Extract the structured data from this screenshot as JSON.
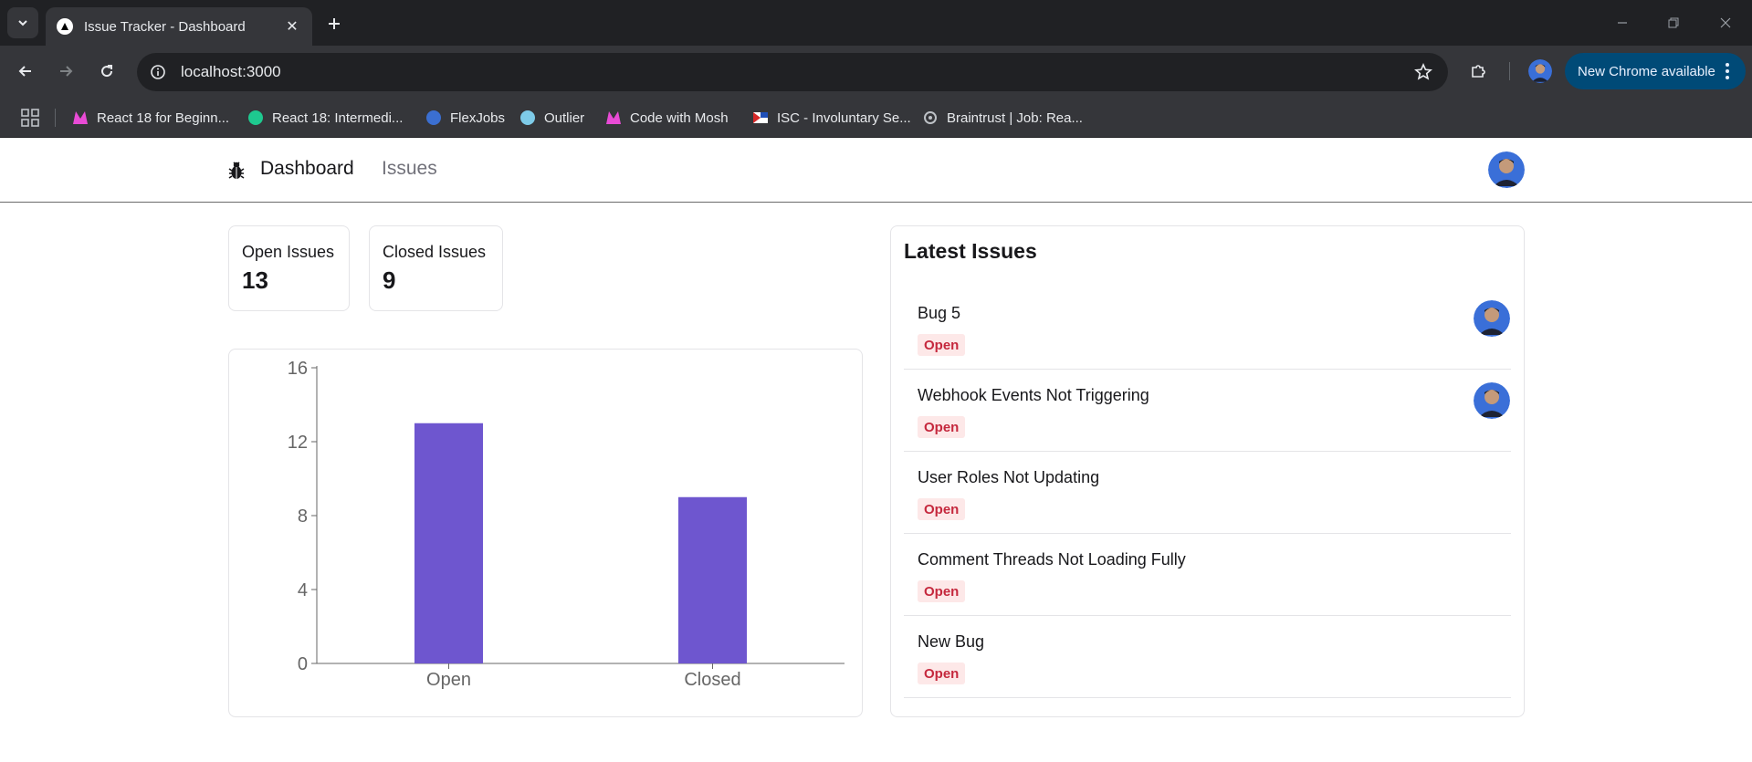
{
  "browser": {
    "tab": {
      "title": "Issue Tracker - Dashboard"
    },
    "url": "localhost:3000",
    "update_button": "New Chrome available",
    "bookmarks": [
      {
        "label": "React 18 for Beginn...",
        "icon": "codewithmosh-icon",
        "color": "#e94bd6"
      },
      {
        "label": "React 18: Intermedi...",
        "icon": "teachable-icon",
        "color": "#1ec98f"
      },
      {
        "label": "FlexJobs",
        "icon": "flexjobs-icon",
        "color": "#3b6fd1"
      },
      {
        "label": "Outlier",
        "icon": "outlier-icon",
        "color": "#7ecbe8"
      },
      {
        "label": "Code with Mosh",
        "icon": "codewithmosh-icon",
        "color": "#e94bd6"
      },
      {
        "label": "ISC - Involuntary Se...",
        "icon": "flag-icon",
        "color": "#d62828"
      },
      {
        "label": "Braintrust | Job: Rea...",
        "icon": "gear-icon",
        "color": "#bdc1c6"
      }
    ]
  },
  "nav": {
    "links": [
      "Dashboard",
      "Issues"
    ]
  },
  "summary": [
    {
      "label": "Open Issues",
      "value": "13"
    },
    {
      "label": "Closed Issues",
      "value": "9"
    }
  ],
  "chart_data": {
    "type": "bar",
    "categories": [
      "Open",
      "Closed"
    ],
    "values": [
      13,
      9
    ],
    "ylim": [
      0,
      16
    ],
    "yticks": [
      0,
      4,
      8,
      12,
      16
    ],
    "color": "#6e56cf"
  },
  "latest": {
    "title": "Latest Issues",
    "issues": [
      {
        "title": "Bug 5",
        "status": "Open",
        "assigned": true
      },
      {
        "title": "Webhook Events Not Triggering",
        "status": "Open",
        "assigned": true
      },
      {
        "title": "User Roles Not Updating",
        "status": "Open",
        "assigned": false
      },
      {
        "title": "Comment Threads Not Loading Fully",
        "status": "Open",
        "assigned": false
      },
      {
        "title": "New Bug",
        "status": "Open",
        "assigned": false
      }
    ]
  },
  "colors": {
    "accent": "#6e56cf",
    "open_badge_bg": "#fde8e8",
    "open_badge_text": "#c5283d"
  }
}
